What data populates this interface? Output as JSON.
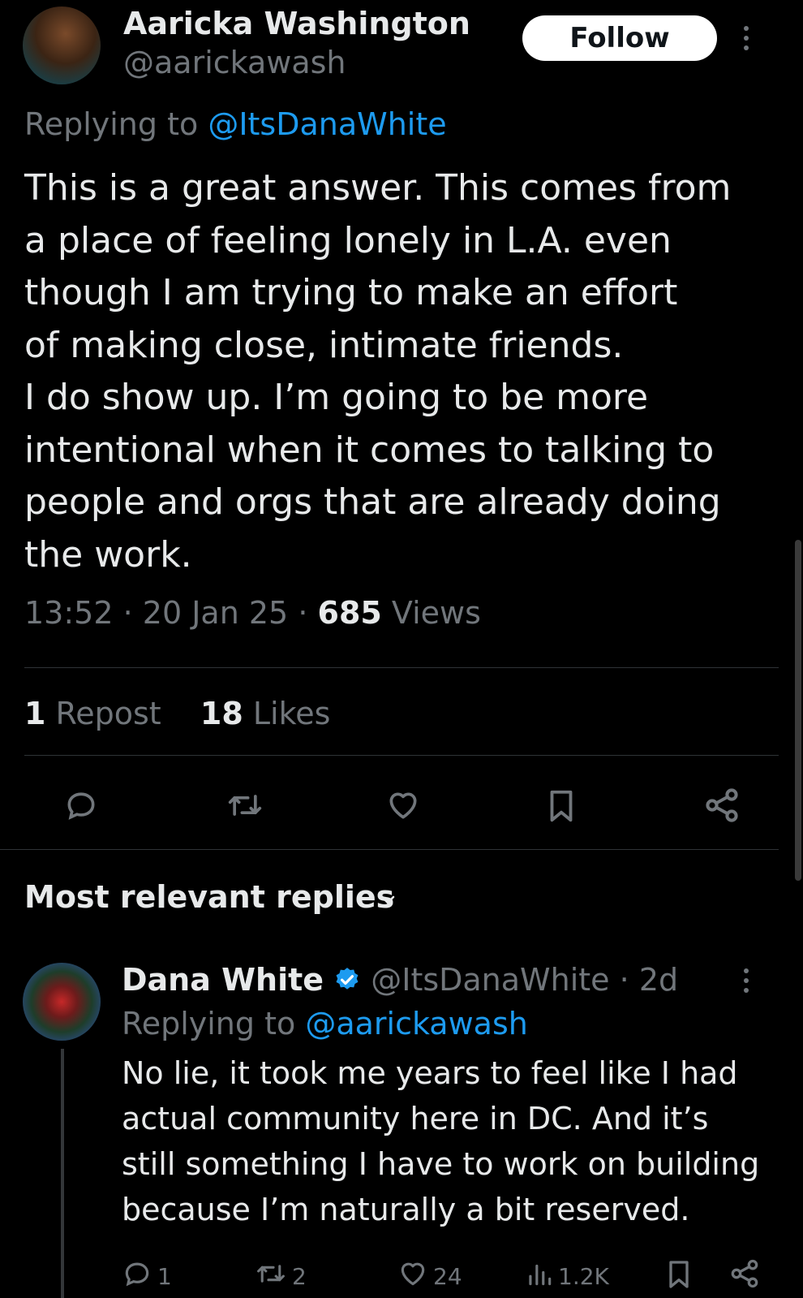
{
  "tweet": {
    "author_name": "Aaricka Washington",
    "author_handle": "@aarickawash",
    "follow_label": "Follow",
    "replying_prefix": "Replying to",
    "replying_to": "@ItsDanaWhite",
    "text": "This is a great answer. This comes from\na place of feeling lonely in L.A. even\nthough I am trying to make an effort\nof making close, intimate friends.\nI do show up. I’m going to be more\nintentional when it comes to talking to\npeople and orgs that are already doing\nthe work.",
    "time": "13:52",
    "date": "20 Jan 25",
    "views_count": "685",
    "views_label": "Views",
    "reposts_count": "1",
    "reposts_label": "Repost",
    "likes_count": "18",
    "likes_label": "Likes"
  },
  "section": {
    "title": "Most relevant replies"
  },
  "reply": {
    "author_name": "Dana White",
    "author_handle": "@ItsDanaWhite",
    "age": "2d",
    "replying_prefix": "Replying to",
    "replying_to": "@aarickawash",
    "text": "No lie, it took me years to feel like I had\nactual community here in DC. And it’s\nstill something I have to work on building\nbecause I’m naturally a bit reserved.",
    "replies_count": "1",
    "reposts_count": "2",
    "likes_count": "24",
    "views_count": "1.2K"
  },
  "colors": {
    "background": "#000000",
    "text": "#e7e9ea",
    "muted": "#71767b",
    "accent": "#1d9bf0",
    "divider": "#2f3336"
  },
  "icons": [
    "more-icon",
    "reply-icon",
    "repost-icon",
    "like-icon",
    "bookmark-icon",
    "share-icon",
    "chevron-down-icon",
    "verified-badge-icon",
    "views-icon"
  ]
}
